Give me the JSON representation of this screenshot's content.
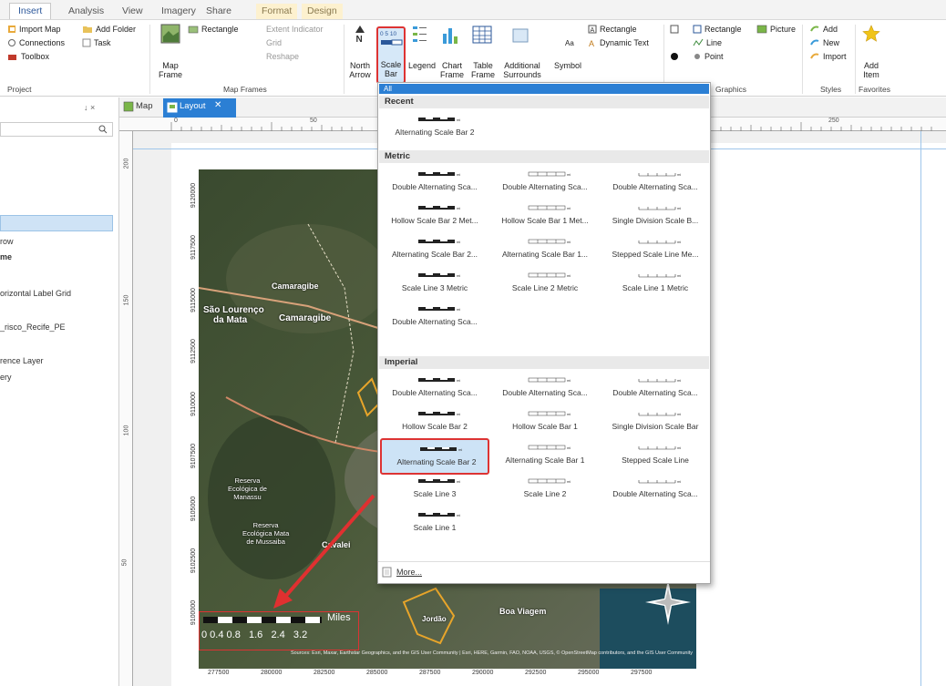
{
  "tabs": [
    "Insert",
    "Analysis",
    "View",
    "Imagery",
    "Share",
    "Format",
    "Design"
  ],
  "ribbon": {
    "project": {
      "import_map": "Import Map",
      "add_folder": "Add Folder",
      "connections": "Connections",
      "task": "Task",
      "toolbox": "Toolbox",
      "group": "Project"
    },
    "map_frames": {
      "map_frame": "Map",
      "map_frame2": "Frame",
      "rectangle": "Rectangle",
      "extent_indicator": "Extent Indicator",
      "grid": "Grid",
      "reshape": "Reshape",
      "group": "Map Frames"
    },
    "surrounds": {
      "north_arrow": "North",
      "north_arrow2": "Arrow",
      "scale_bar": "Scale",
      "scale_bar2": "Bar",
      "scale_icon_text": "0 5 10",
      "legend": "Legend",
      "chart_frame": "Chart",
      "chart_frame2": "Frame",
      "table_frame": "Table",
      "table_frame2": "Frame",
      "additional_surrounds": "Additional",
      "additional_surrounds2": "Surrounds"
    },
    "text": {
      "symbol": "Symbol",
      "symbol_icon": "Aa",
      "rectangle": "Rectangle",
      "dynamic_text": "Dynamic Text"
    },
    "graphics": {
      "rectangle": "Rectangle",
      "picture": "Picture",
      "line": "Line",
      "point": "Point",
      "group": "Graphics"
    },
    "styles": {
      "add": "Add",
      "new": "New",
      "import": "Import",
      "group": "Styles"
    },
    "favorites": {
      "add_item": "Add",
      "add_item2": "Item",
      "group": "Favorites"
    }
  },
  "left_pane": {
    "items": [
      "row",
      "me",
      "orizontal Label Grid",
      "_risco_Recife_PE",
      "rence Layer",
      "ery"
    ],
    "pin": "↓ ×"
  },
  "doc_tabs": {
    "map": "Map",
    "layout": "Layout"
  },
  "ruler": {
    "h": [
      "0",
      "50",
      "250"
    ],
    "v": [
      "200",
      "150",
      "100",
      "50"
    ]
  },
  "map": {
    "labels": {
      "camaragibe": "Camaragibe",
      "sao_lourenco": "São Lourenço",
      "da_mata": "da Mata",
      "camaragibe2": "Camaragibe",
      "reserva1": "Reserva\nEcológica de\nManassu",
      "reserva2": "Reserva\nEcológica Mata\nde Mussaiba",
      "cavaleiro": "Cavalei",
      "boa_viagem": "Boa Viagem",
      "jordao": "Jordão"
    },
    "y_coords": [
      "9120000",
      "9117500",
      "9115000",
      "9112500",
      "9110000",
      "9107500",
      "9105000",
      "9102500",
      "9100000"
    ],
    "x_coords": [
      "277500",
      "280000",
      "282500",
      "285000",
      "287500",
      "290000",
      "292500",
      "295000",
      "297500"
    ],
    "credits": "Sources: Esri, Maxar, Earthstar Geographics, and the GIS User Community | Esri, HERE, Garmin, FAO, NOAA, USGS, © OpenStreetMap contributors, and the GIS User Community",
    "scalebar": {
      "unit": "Miles",
      "ticks": "0 0.4 0.8   1.6   2.4   3.2"
    }
  },
  "gallery": {
    "filter": "All",
    "sections": {
      "recent": "Recent",
      "metric": "Metric",
      "imperial": "Imperial"
    },
    "recent": [
      "Alternating Scale Bar 2"
    ],
    "metric": [
      "Double Alternating Sca...",
      "Double Alternating Sca...",
      "Double Alternating Sca...",
      "Hollow Scale Bar 2 Met...",
      "Hollow Scale Bar 1 Met...",
      "Single Division Scale B...",
      "Alternating Scale Bar 2...",
      "Alternating Scale Bar 1...",
      "Stepped Scale Line Me...",
      "Scale Line 3 Metric",
      "Scale Line 2 Metric",
      "Scale Line 1 Metric",
      "Double Alternating Sca..."
    ],
    "imperial": [
      "Double Alternating Sca...",
      "Double Alternating Sca...",
      "Double Alternating Sca...",
      "Hollow Scale Bar 2",
      "Hollow Scale Bar 1",
      "Single Division Scale Bar",
      "Alternating Scale Bar 2",
      "Alternating Scale Bar 1",
      "Stepped Scale Line",
      "Scale Line 3",
      "Scale Line 2",
      "Double Alternating Sca...",
      "Scale Line 1"
    ],
    "more": "More..."
  },
  "colors": {
    "accent": "#2b579a",
    "highlight": "#d33333"
  }
}
